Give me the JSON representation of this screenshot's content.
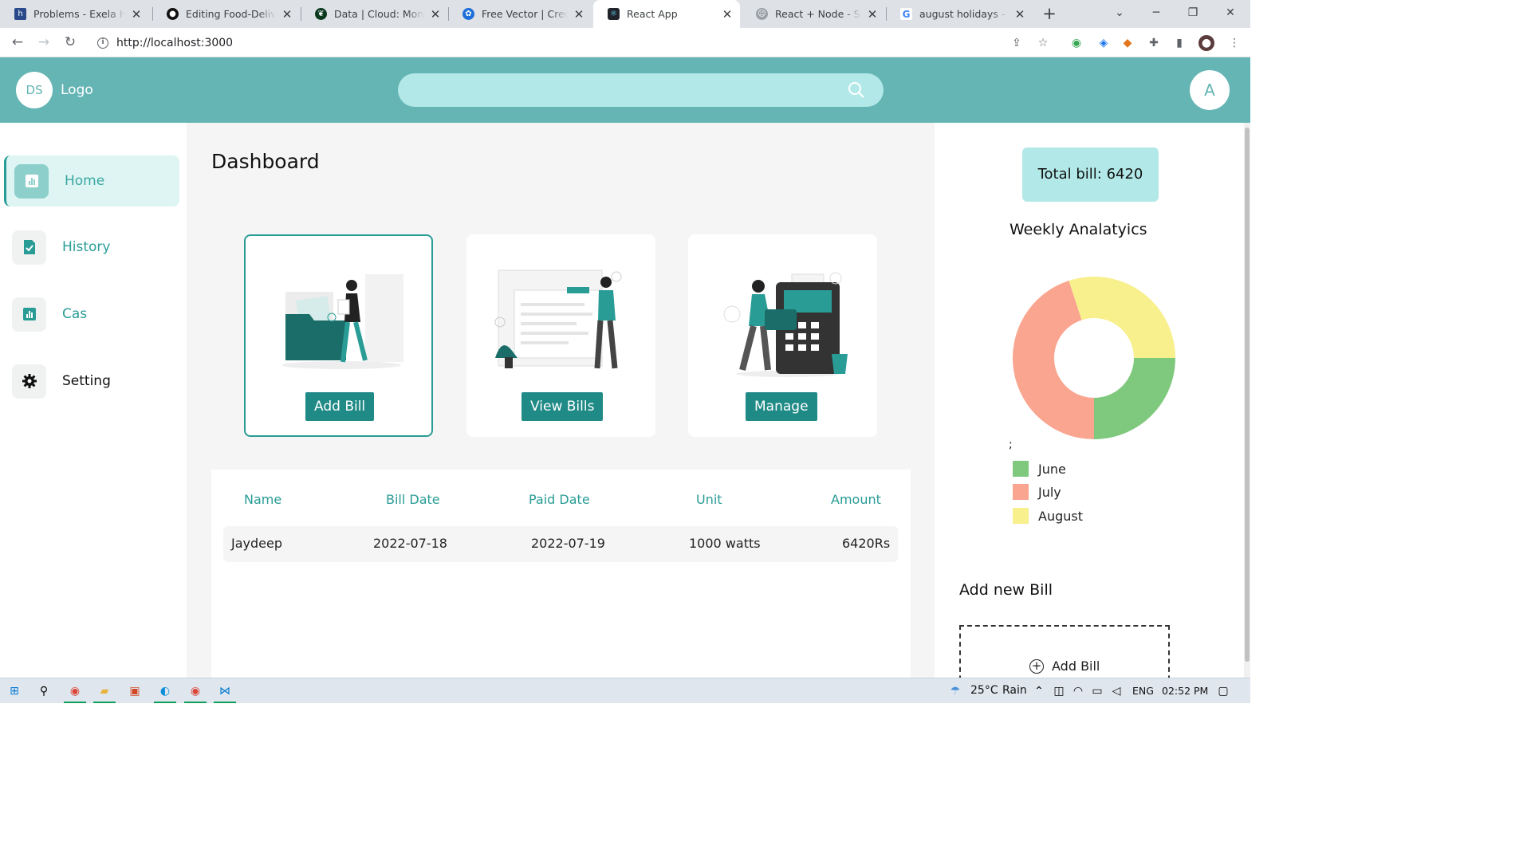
{
  "browser": {
    "tabs": [
      {
        "title": "Problems - Exela Hiring"
      },
      {
        "title": "Editing Food-Delivery"
      },
      {
        "title": "Data | Cloud: MongoDB"
      },
      {
        "title": "Free Vector | Credit card"
      },
      {
        "title": "React App"
      },
      {
        "title": "React + Node - Server"
      },
      {
        "title": "august holidays - Google"
      }
    ],
    "url": "http://localhost:3000"
  },
  "header": {
    "initials": "DS",
    "logo": "Logo",
    "avatar": "A"
  },
  "sidebar": {
    "items": [
      {
        "label": "Home"
      },
      {
        "label": "History"
      },
      {
        "label": "Cas"
      },
      {
        "label": "Setting"
      }
    ]
  },
  "main": {
    "title": "Dashboard",
    "cards": [
      {
        "button": "Add Bill"
      },
      {
        "button": "View Bills"
      },
      {
        "button": "Manage"
      }
    ],
    "table": {
      "headers": [
        "Name",
        "Bill Date",
        "Paid Date",
        "Unit",
        "Amount"
      ],
      "rows": [
        {
          "name": "Jaydeep",
          "bill_date": "2022-07-18",
          "paid_date": "2022-07-19",
          "unit": "1000 watts",
          "amount": "6420Rs"
        }
      ]
    }
  },
  "right": {
    "total": "Total bill: 6420",
    "analytics_title": "Weekly Analatyics",
    "stray": ";",
    "add_title": "Add new Bill",
    "add_label": "Add Bill"
  },
  "chart_data": {
    "type": "pie",
    "categories": [
      "June",
      "July",
      "August"
    ],
    "values": [
      25,
      45,
      30
    ],
    "colors": [
      "#7fc97f",
      "#f9a58f",
      "#f8ef8d"
    ],
    "legend": "bottom"
  },
  "taskbar": {
    "weather": "25°C",
    "weather_desc": "Rain",
    "lang": "ENG",
    "time": "02:52 PM"
  }
}
